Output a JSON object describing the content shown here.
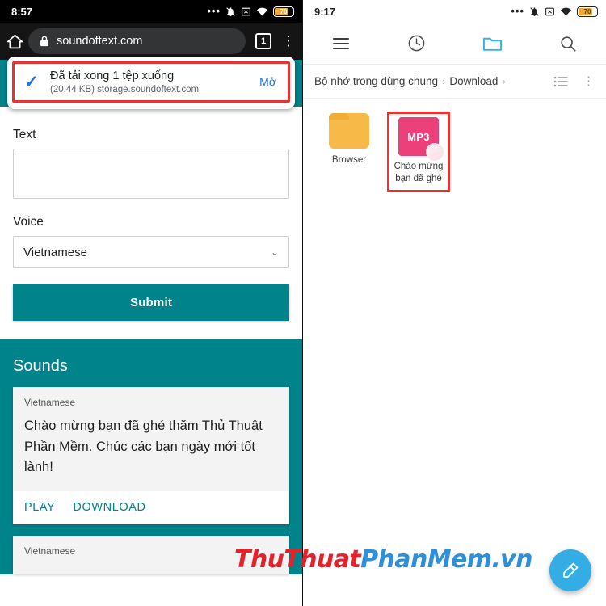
{
  "left_phone": {
    "status_bar": {
      "time": "8:57",
      "icons": [
        "more-dots-icon",
        "mute-bell-icon",
        "x-box-icon",
        "wifi-icon"
      ],
      "battery_level": "70"
    },
    "browser": {
      "home_icon": "home-icon",
      "lock_icon": "lock-icon",
      "url": "soundoftext.com",
      "tab_count": "1",
      "menu_icon": "kebab-menu-icon"
    },
    "download_bar": {
      "check_icon": "check-icon",
      "title": "Đã tải xong 1 tệp xuống",
      "subtitle": "(20,44 KB) storage.soundoftext.com",
      "open_label": "Mở",
      "highlight_color": "#e8332f"
    },
    "form": {
      "text_label": "Text",
      "text_value": "",
      "text_placeholder": "",
      "voice_label": "Voice",
      "voice_selected": "Vietnamese",
      "submit_label": "Submit"
    },
    "sounds": {
      "heading": "Sounds",
      "cards": [
        {
          "language": "Vietnamese",
          "text": "Chào mừng bạn đã ghé thăm Thủ Thuật Phần Mềm. Chúc các bạn ngày mới tốt lành!",
          "play_label": "PLAY",
          "download_label": "DOWNLOAD"
        },
        {
          "language": "Vietnamese"
        }
      ]
    },
    "theme": {
      "accent": "#00838a"
    }
  },
  "right_phone": {
    "status_bar": {
      "time": "9:17",
      "icons": [
        "more-dots-icon",
        "mute-bell-icon",
        "x-box-icon",
        "wifi-icon"
      ],
      "battery_level": "70"
    },
    "toolbar": {
      "menu_icon": "hamburger-menu-icon",
      "recent_icon": "clock-history-icon",
      "files_icon": "folder-icon",
      "search_icon": "search-icon",
      "active_tab": "files"
    },
    "breadcrumb": {
      "parts": [
        "Bộ nhớ trong dùng chung",
        "Download"
      ],
      "separator": "›",
      "view_icon": "list-view-icon",
      "overflow_icon": "vertical-dots-icon"
    },
    "files": [
      {
        "name": "Browser",
        "icon": "folder-icon",
        "type": "folder",
        "selected": false
      },
      {
        "name": "Chào mừng bạn đã ghé",
        "icon": "mp3-file-icon",
        "badge": "MP3",
        "type": "audio",
        "selected": true
      }
    ],
    "fab": {
      "icon": "brush-cleaner-icon",
      "color": "#33ade3"
    }
  },
  "watermark": {
    "part_red": "ThuThuat",
    "part_blue": "PhanMem.vn"
  }
}
